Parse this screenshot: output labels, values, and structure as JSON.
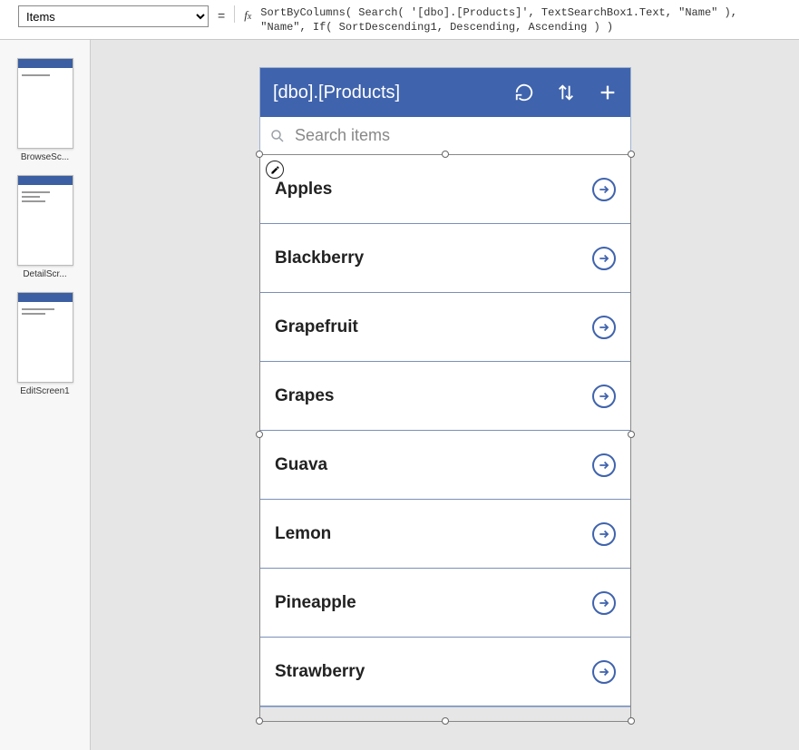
{
  "propertyDropdown": "Items",
  "formula": "SortByColumns( Search( '[dbo].[Products]', TextSearchBox1.Text, \"Name\" ),\n\"Name\", If( SortDescending1, Descending, Ascending ) )",
  "thumbs": [
    {
      "label": "BrowseSc..."
    },
    {
      "label": "DetailScr..."
    },
    {
      "label": "EditScreen1"
    }
  ],
  "app": {
    "title": "[dbo].[Products]",
    "searchPlaceholder": "Search items",
    "items": [
      {
        "name": "Apples"
      },
      {
        "name": "Blackberry"
      },
      {
        "name": "Grapefruit"
      },
      {
        "name": "Grapes"
      },
      {
        "name": "Guava"
      },
      {
        "name": "Lemon"
      },
      {
        "name": "Pineapple"
      },
      {
        "name": "Strawberry"
      }
    ]
  }
}
